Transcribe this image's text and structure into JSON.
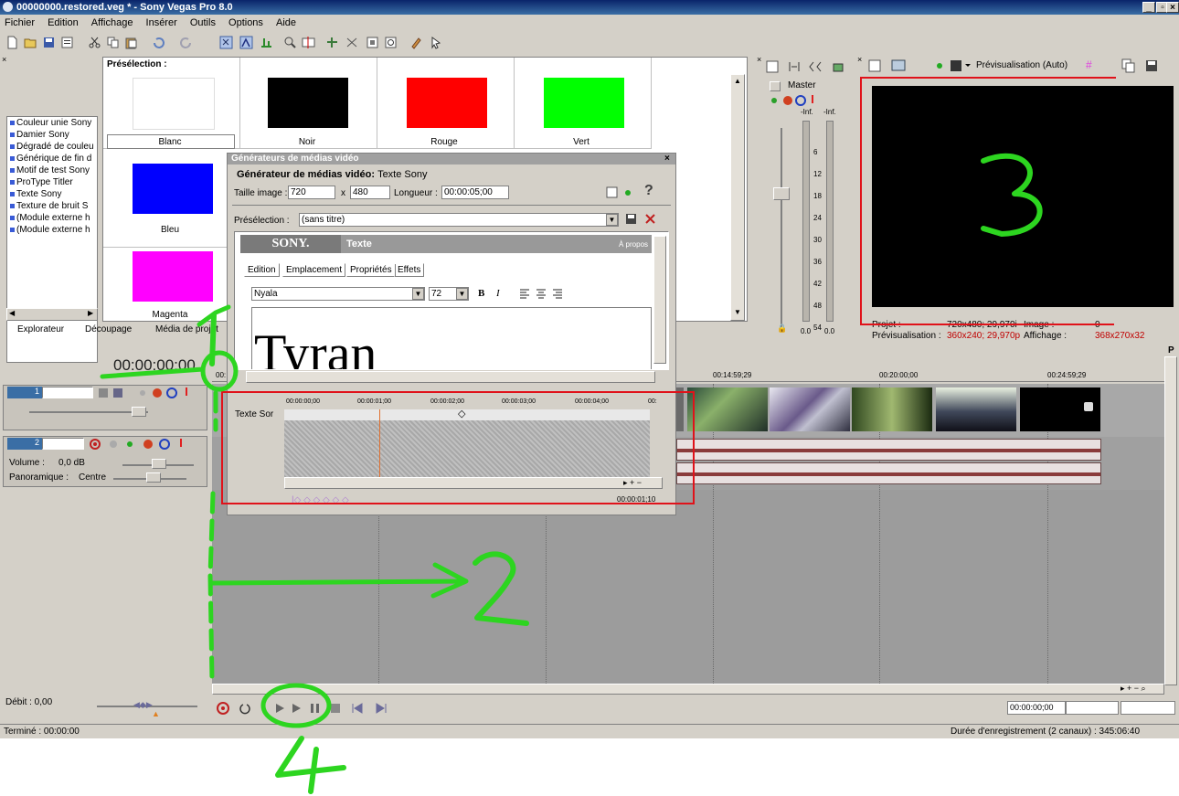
{
  "window": {
    "title": "00000000.restored.veg * - Sony Vegas Pro 8.0",
    "controls": [
      "_",
      "×"
    ]
  },
  "menu": [
    "Fichier",
    "Edition",
    "Affichage",
    "Insérer",
    "Outils",
    "Options",
    "Aide"
  ],
  "explorer": {
    "generators": [
      "Couleur unie Sony",
      "Damier Sony",
      "Dégradé de couleu",
      "Générique de fin d",
      "Motif de test Sony",
      "ProType Titler",
      "Texte Sony",
      "Texture de bruit S",
      "(Module externe h",
      "(Module externe h"
    ],
    "preset_header": "Présélection :",
    "presets": [
      {
        "label": "Blanc",
        "color": "#ffffff"
      },
      {
        "label": "Noir",
        "color": "#000000"
      },
      {
        "label": "Rouge",
        "color": "#ff0000"
      },
      {
        "label": "Vert",
        "color": "#00ff00"
      },
      {
        "label": "Bleu",
        "color": "#0000ff"
      },
      {
        "label": "Magenta",
        "color": "#ff00ff"
      }
    ],
    "tabs": [
      "Explorateur",
      "Découpage",
      "Média de projet"
    ]
  },
  "mixer": {
    "master_label": "Master",
    "inf_left": "-Inf.",
    "inf_right": "-Inf.",
    "scale": [
      "6",
      "12",
      "18",
      "24",
      "30",
      "36",
      "42",
      "48",
      "54"
    ],
    "value_left": "0.0",
    "value_right": "0.0"
  },
  "preview": {
    "mode_label": "Prévisualisation (Auto)",
    "project_label": "Projet :",
    "project_value": "720x480; 29,970i",
    "image_label": "Image :",
    "image_value": "0",
    "preview_label": "Prévisualisation :",
    "preview_value": "360x240; 29,970p",
    "display_label": "Affichage :",
    "display_value": "368x270x32"
  },
  "dialog": {
    "window_title": "Générateurs de médias vidéo",
    "heading_label": "Générateur de médias vidéo:",
    "heading_value": "Texte Sony",
    "size_label": "Taille image :",
    "width": "720",
    "x_sep": "x",
    "height": "480",
    "length_label": "Longueur :",
    "length_value": "00:00:05;00",
    "help_glyph": "?",
    "preset_label": "Présélection :",
    "preset_value": "(sans titre)",
    "brand": "SONY.",
    "plugin_name": "Texte",
    "about": "À propos",
    "tabs": [
      "Edition",
      "Emplacement",
      "Propriétés",
      "Effets"
    ],
    "font": "Nyala",
    "font_size": "72",
    "bold": "B",
    "italic": "I",
    "sample_text": "Tyran",
    "keyframe_track_label": "Texte Sor",
    "kf_ruler": [
      "00:00:00;00",
      "00:00:01;00",
      "00:00:02;00",
      "00:00:03;00",
      "00:00:04;00",
      "00:"
    ],
    "kf_time": "00:00:01;10"
  },
  "timeline": {
    "time_display": "00:00:00;00",
    "ruler_labels": [
      "00:14:59;29",
      "00:20:00;00",
      "00:24:59;29"
    ],
    "ruler_start": "00:",
    "track1_number": "1",
    "track2_number": "2",
    "volume_label": "Volume :",
    "volume_value": "0,0 dB",
    "pan_label": "Panoramique :",
    "pan_value": "Centre",
    "rate_label": "Débit : 0,00",
    "transport_time": "00:00:00;00"
  },
  "status": {
    "left": "Terminé : 00:00:00",
    "right": "Durée d'enregistrement (2 canaux) : 345:06:40"
  },
  "annotations": {
    "labels": [
      "1",
      "2",
      "3",
      "4"
    ],
    "stroke_color": "#2dd520",
    "box_color": "#e0121a"
  }
}
